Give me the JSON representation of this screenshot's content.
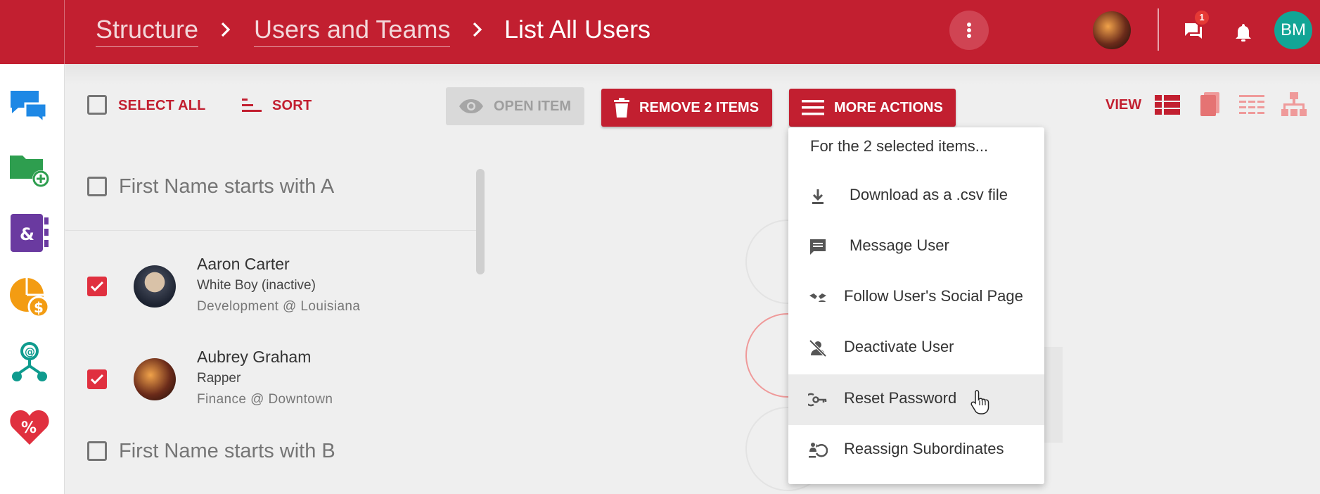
{
  "colors": {
    "brand": "#c21f30",
    "accent_check": "#e0303f",
    "avatar_bm": "#12a596"
  },
  "header": {
    "breadcrumbs": [
      {
        "label": "Structure",
        "link": true
      },
      {
        "label": "Users and Teams",
        "link": true
      },
      {
        "label": "List All Users",
        "link": false
      }
    ],
    "notification_count": "1",
    "user_initials": "BM"
  },
  "rail": {
    "icons": [
      "chat-bubbles-icon",
      "add-folder-icon",
      "contacts-book-icon",
      "pie-chart-money-icon",
      "org-network-icon",
      "heart-percent-icon"
    ]
  },
  "toolbar": {
    "select_all": "SELECT ALL",
    "sort": "SORT",
    "open_item": "OPEN ITEM",
    "remove_items": "REMOVE 2 ITEMS",
    "more_actions": "MORE ACTIONS",
    "view": "VIEW"
  },
  "list": {
    "groups": [
      {
        "title": "First Name starts with A"
      },
      {
        "title": "First Name starts with B"
      }
    ],
    "users": [
      {
        "name": "Aaron Carter",
        "title": "White Boy (inactive)",
        "dept": "Development @ Louisiana",
        "checked": true
      },
      {
        "name": "Aubrey Graham",
        "title": "Rapper",
        "dept": "Finance @ Downtown",
        "checked": true
      }
    ]
  },
  "menu": {
    "header": "For the 2 selected items...",
    "items": [
      {
        "label": "Download as a .csv file",
        "icon": "download-icon"
      },
      {
        "label": "Message User",
        "icon": "message-icon"
      },
      {
        "label": "Follow User's Social Page",
        "icon": "follow-social-icon"
      },
      {
        "label": "Deactivate User",
        "icon": "deactivate-user-icon"
      },
      {
        "label": "Reset Password",
        "icon": "reset-key-icon",
        "hovered": true
      },
      {
        "label": "Reassign Subordinates",
        "icon": "reassign-icon"
      }
    ]
  }
}
